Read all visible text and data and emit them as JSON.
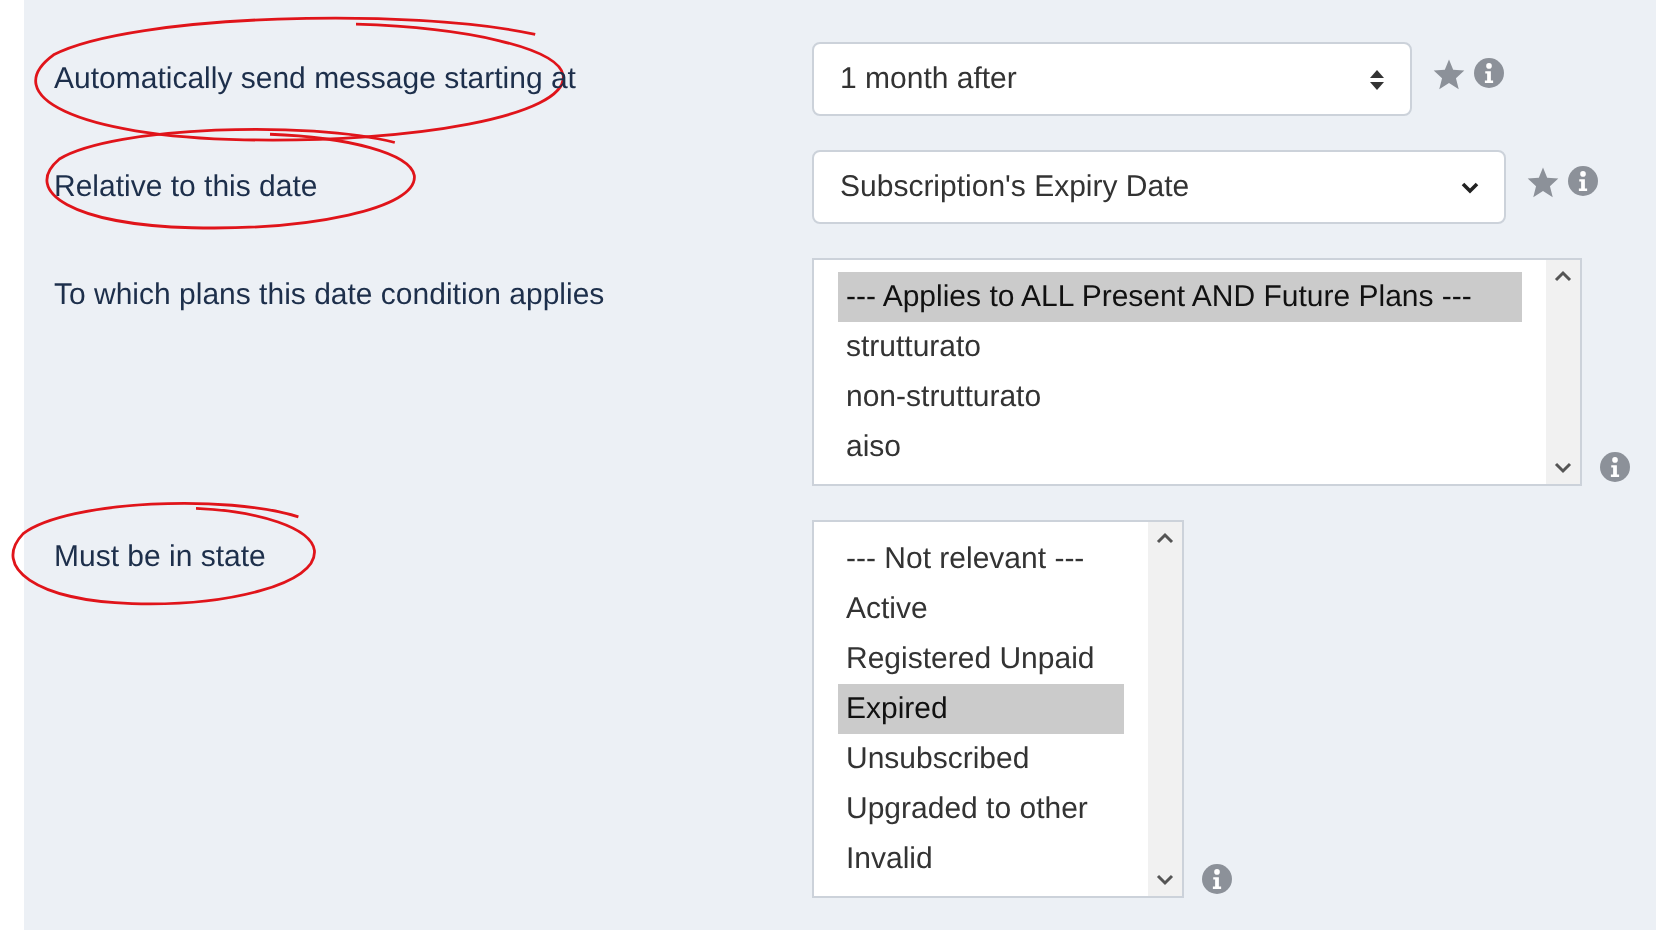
{
  "fields": [
    {
      "kind": "stepper-select",
      "label": "Automatically send message starting at",
      "circled": true,
      "value": "1 month after",
      "starred": true
    },
    {
      "kind": "dropdown",
      "label": "Relative to this date",
      "circled": true,
      "value": "Subscription's Expiry Date",
      "starred": true
    },
    {
      "kind": "listbox",
      "label": "To which plans this date condition applies",
      "circled": false,
      "wide": true,
      "options": [
        {
          "text": "--- Applies to ALL Present AND Future Plans ---",
          "selected": true
        },
        {
          "text": "strutturato",
          "selected": false
        },
        {
          "text": "non-strutturato",
          "selected": false
        },
        {
          "text": "aiso",
          "selected": false
        }
      ]
    },
    {
      "kind": "listbox",
      "label": "Must be in state",
      "circled": true,
      "wide": false,
      "options": [
        {
          "text": "--- Not relevant ---",
          "selected": false
        },
        {
          "text": "Active",
          "selected": false
        },
        {
          "text": "Registered Unpaid",
          "selected": false
        },
        {
          "text": "Expired",
          "selected": true
        },
        {
          "text": "Unsubscribed",
          "selected": false
        },
        {
          "text": "Upgraded to other",
          "selected": false
        },
        {
          "text": "Invalid",
          "selected": false
        }
      ]
    }
  ]
}
